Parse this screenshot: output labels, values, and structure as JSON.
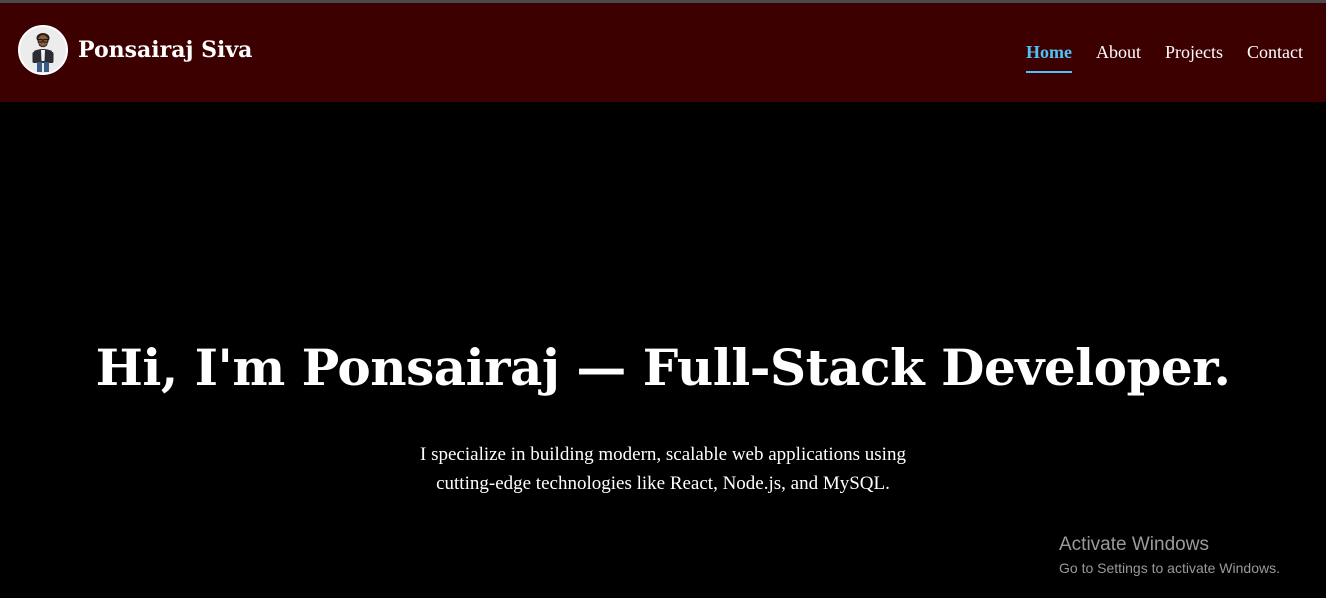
{
  "colors": {
    "navbar_bg": "#3d0000",
    "page_bg": "#000000",
    "accent": "#4fc3f7",
    "text": "#ffffff",
    "watermark": "#9a9a9a"
  },
  "header": {
    "brand_name": "Ponsairaj Siva",
    "avatar_icon": "avatar-icon"
  },
  "nav": {
    "items": [
      {
        "label": "Home",
        "active": true
      },
      {
        "label": "About",
        "active": false
      },
      {
        "label": "Projects",
        "active": false
      },
      {
        "label": "Contact",
        "active": false
      }
    ]
  },
  "hero": {
    "title": "Hi, I'm Ponsairaj — Full-Stack Developer.",
    "subtitle_line1": "I specialize in building modern, scalable web applications using",
    "subtitle_line2": "cutting-edge technologies like React, Node.js, and MySQL."
  },
  "watermark": {
    "title": "Activate Windows",
    "subtitle": "Go to Settings to activate Windows."
  }
}
